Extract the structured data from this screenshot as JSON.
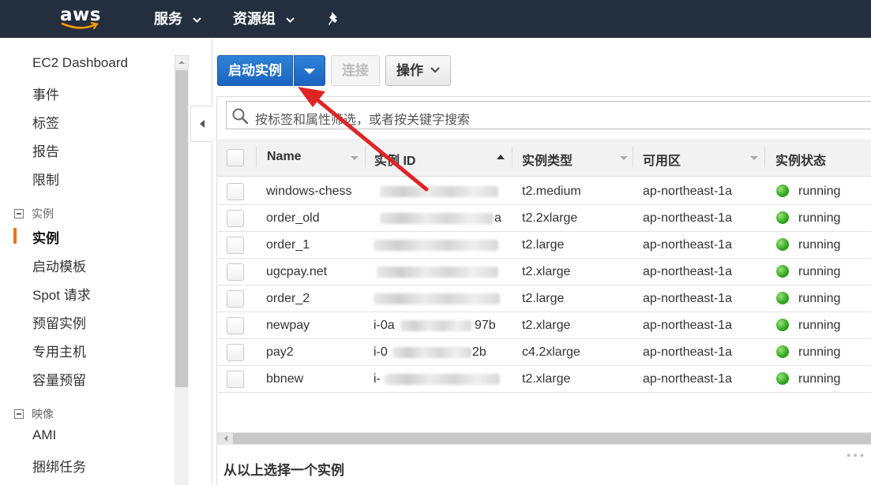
{
  "header": {
    "logo_text": "aws",
    "nav": [
      {
        "label": "服务"
      },
      {
        "label": "资源组"
      }
    ]
  },
  "sidebar": {
    "top_links": [
      "EC2 Dashboard",
      "事件",
      "标签",
      "报告",
      "限制"
    ],
    "sections": [
      {
        "title": "实例",
        "items": [
          "实例",
          "启动模板",
          "Spot 请求",
          "预留实例",
          "专用主机",
          "容量预留"
        ]
      },
      {
        "title": "映像",
        "items": [
          "AMI",
          "捆绑任务"
        ]
      }
    ],
    "active_item": "实例"
  },
  "toolbar": {
    "launch_label": "启动实例",
    "connect_label": "连接",
    "actions_label": "操作"
  },
  "search": {
    "placeholder": "按标签和属性筛选，或者按关键字搜索"
  },
  "table": {
    "columns": [
      "Name",
      "实例 ID",
      "实例类型",
      "可用区",
      "实例状态"
    ],
    "sorted_column": "实例 ID",
    "rows": [
      {
        "name": "windows-chess",
        "id_visible": "",
        "type": "t2.medium",
        "az": "ap-northeast-1a",
        "state": "running"
      },
      {
        "name": "order_old",
        "id_visible": "a",
        "type": "t2.2xlarge",
        "az": "ap-northeast-1a",
        "state": "running"
      },
      {
        "name": "order_1",
        "id_visible": "",
        "type": "t2.large",
        "az": "ap-northeast-1a",
        "state": "running"
      },
      {
        "name": "ugcpay.net",
        "id_visible": "",
        "type": "t2.xlarge",
        "az": "ap-northeast-1a",
        "state": "running"
      },
      {
        "name": "order_2",
        "id_visible": "",
        "type": "t2.large",
        "az": "ap-northeast-1a",
        "state": "running"
      },
      {
        "name": "newpay",
        "id_visible": "i-0a",
        "id_suffix": "97b",
        "type": "t2.xlarge",
        "az": "ap-northeast-1a",
        "state": "running"
      },
      {
        "name": "pay2",
        "id_visible": "i-0",
        "id_suffix": "2b",
        "type": "c4.2xlarge",
        "az": "ap-northeast-1a",
        "state": "running"
      },
      {
        "name": "bbnew",
        "id_visible": "i-",
        "type": "t2.xlarge",
        "az": "ap-northeast-1a",
        "state": "running"
      }
    ]
  },
  "details": {
    "title": "从以上选择一个实例"
  },
  "colors": {
    "header_bg": "#232f3e",
    "primary_button": "#1f6fcc",
    "active_indicator": "#ec7211",
    "running": "#2ea41c",
    "annotation_arrow": "#e02424"
  }
}
